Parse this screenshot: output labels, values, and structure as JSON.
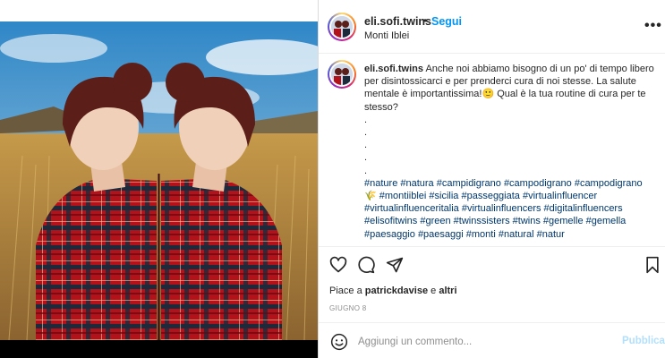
{
  "post": {
    "username": "eli.sofi.twins",
    "separator": "•",
    "follow_label": "Segui",
    "location": "Monti Iblei",
    "more_icon": "more-options-icon",
    "more_label": "•••"
  },
  "caption": {
    "username": "eli.sofi.twins",
    "text": "Anche noi abbiamo bisogno di un po' di tempo libero per disintossicarci e per prenderci cura di noi stesse. La salute mentale è importantissima!🙂 Qual è la tua routine di cura per te stesso?",
    "dots": [
      ".",
      ".",
      ".",
      ".",
      "."
    ],
    "hashtags_line1": "#nature #natura #campidigrano #campodigrano #campodigrano",
    "hashtags_line2_emoji": "🌾",
    "hashtags_line2": "#montiiblei #sicilia #passeggiata #virtualinfluencer",
    "hashtags_line3": "#virtualinfluenceritalia #virtualinfluencers #digitalinfluencers",
    "hashtags_line4": "#elisofitwins #green #twinssisters #twins #gemelle #gemella",
    "hashtags_line5": "#paesaggio #paesaggi #monti #natural #natur"
  },
  "actions": {
    "likes_prefix": "Piace a",
    "likes_user": "patrickdavise",
    "likes_join": "e",
    "likes_others": "altri",
    "date": "GIUGNO 8"
  },
  "comment": {
    "placeholder": "Aggiungi un commento...",
    "publish_label": "Pubblica"
  },
  "colors": {
    "accent": "#0095f6",
    "hashtag": "#00376b",
    "publish_disabled": "#b2dffc",
    "secondary_text": "#8e8e8e"
  }
}
